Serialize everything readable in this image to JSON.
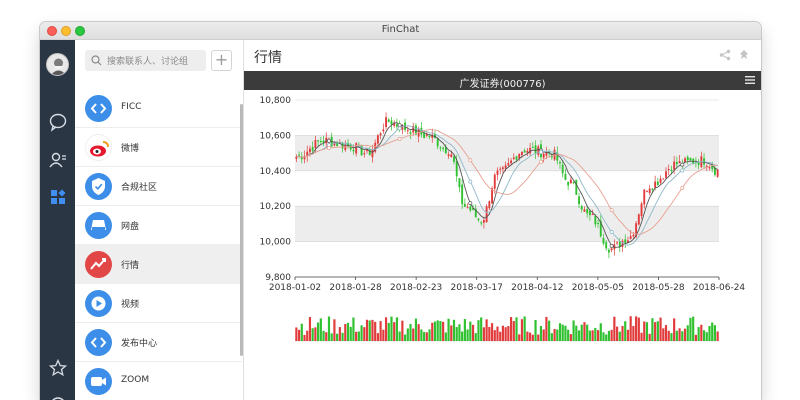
{
  "window": {
    "title": "FinChat"
  },
  "search": {
    "placeholder": "搜索联系人、讨论组",
    "add_label": "+"
  },
  "rail": {
    "icons": [
      "chat-icon",
      "contacts-icon",
      "apps-icon",
      "star-icon",
      "check-circle-icon"
    ]
  },
  "list": [
    {
      "label": "FICC",
      "icon": "code-icon",
      "color": "#3d8ee8"
    },
    {
      "label": "微博",
      "icon": "weibo-icon",
      "color": "#e7a72c"
    },
    {
      "label": "合规社区",
      "icon": "shield-icon",
      "color": "#3d8ee8"
    },
    {
      "label": "网盘",
      "icon": "disk-icon",
      "color": "#3d8ee8"
    },
    {
      "label": "行情",
      "icon": "trend-icon",
      "color": "#e14747",
      "active": true
    },
    {
      "label": "视频",
      "icon": "play-icon",
      "color": "#3d8ee8"
    },
    {
      "label": "发布中心",
      "icon": "publish-icon",
      "color": "#3d8ee8"
    },
    {
      "label": "ZOOM",
      "icon": "camera-icon",
      "color": "#3d8ee8"
    }
  ],
  "main": {
    "title": "行情"
  },
  "colors": {
    "up": "#e13b3b",
    "down": "#2fc12f",
    "ma5": "#555555",
    "ma10": "#8fb8c8",
    "ma20": "#e8a090"
  },
  "chart_data": {
    "type": "candlestick",
    "title": "广发证券(000776)",
    "y_ticks": [
      "9,800",
      "10,000",
      "10,200",
      "10,400",
      "10,600",
      "10,800"
    ],
    "ylim": [
      9800,
      10800
    ],
    "x_ticks": [
      "2018-01-02",
      "2018-01-28",
      "2018-02-23",
      "2018-03-17",
      "2018-04-12",
      "2018-05-05",
      "2018-05-28",
      "2018-06-24"
    ],
    "control_points": [
      {
        "i": 0,
        "v": 10480
      },
      {
        "i": 10,
        "v": 10570
      },
      {
        "i": 20,
        "v": 10540
      },
      {
        "i": 26,
        "v": 10500
      },
      {
        "i": 34,
        "v": 10680
      },
      {
        "i": 40,
        "v": 10640
      },
      {
        "i": 48,
        "v": 10600
      },
      {
        "i": 56,
        "v": 10520
      },
      {
        "i": 62,
        "v": 10200
      },
      {
        "i": 68,
        "v": 10120
      },
      {
        "i": 74,
        "v": 10380
      },
      {
        "i": 84,
        "v": 10520
      },
      {
        "i": 94,
        "v": 10500
      },
      {
        "i": 100,
        "v": 10340
      },
      {
        "i": 108,
        "v": 10140
      },
      {
        "i": 116,
        "v": 9960
      },
      {
        "i": 122,
        "v": 10020
      },
      {
        "i": 130,
        "v": 10320
      },
      {
        "i": 140,
        "v": 10440
      },
      {
        "i": 150,
        "v": 10460
      },
      {
        "i": 155,
        "v": 10400
      }
    ]
  }
}
